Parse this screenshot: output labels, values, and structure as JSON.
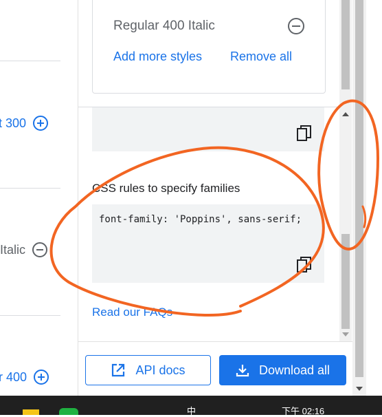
{
  "left_list": {
    "items": [
      {
        "label": "t 300",
        "icon": "add-circle-icon"
      },
      {
        "label": "Italic",
        "icon": "remove-circle-icon"
      },
      {
        "label": "r 400",
        "icon": "add-circle-icon"
      }
    ]
  },
  "selected_styles": {
    "style_label": "Regular 400 Italic",
    "add_more_label": "Add more styles",
    "remove_all_label": "Remove all"
  },
  "embed": {
    "code_top_partial": "",
    "css_section_title": "CSS rules to specify families",
    "css_code": "font-family: 'Poppins', sans-serif;",
    "faq_label": "Read our FAQs"
  },
  "footer": {
    "api_docs_label": "API docs",
    "download_all_label": "Download all"
  },
  "taskbar": {
    "ime": "中",
    "clock": "下午 02:16"
  },
  "colors": {
    "accent": "#1a73e8",
    "annotation": "#f26522"
  }
}
